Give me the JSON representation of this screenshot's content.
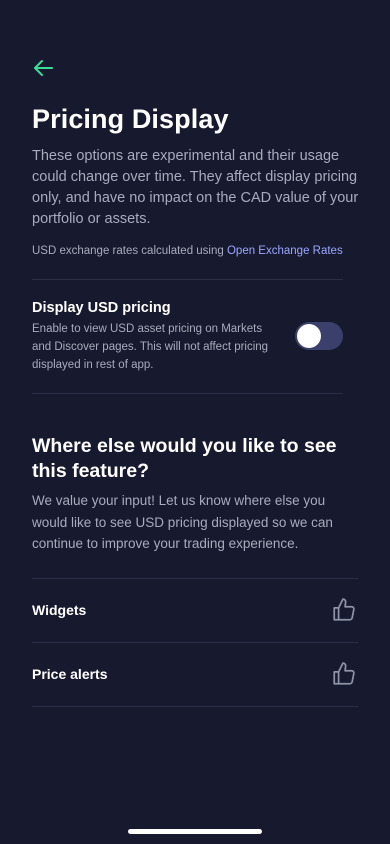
{
  "colors": {
    "background": "#171a2e",
    "accent": "#3ddc97",
    "link": "#9aa6ff",
    "muted_text": "#a8abbd",
    "toggle_track": "#3b3f6b"
  },
  "header": {
    "back_icon": "arrow-left-icon",
    "title": "Pricing Display"
  },
  "intro": {
    "description": "These options are experimental and their usage could change over time. They affect display pricing only, and have no impact on the CAD value of your portfolio or assets.",
    "rates_prefix": "USD exchange rates calculated using ",
    "rates_link": "Open Exchange Rates"
  },
  "usd_setting": {
    "title": "Display USD pricing",
    "description": "Enable to view USD asset pricing on Markets and Discover pages. This will not affect pricing displayed in rest of app.",
    "enabled": false
  },
  "feedback": {
    "title": "Where else would you like to see this feature?",
    "description": "We value your input! Let us know where else you would like to see USD pricing displayed so we can continue to improve your trading experience.",
    "options": [
      {
        "label": "Widgets",
        "icon": "thumbs-up-icon"
      },
      {
        "label": "Price alerts",
        "icon": "thumbs-up-icon"
      }
    ]
  }
}
